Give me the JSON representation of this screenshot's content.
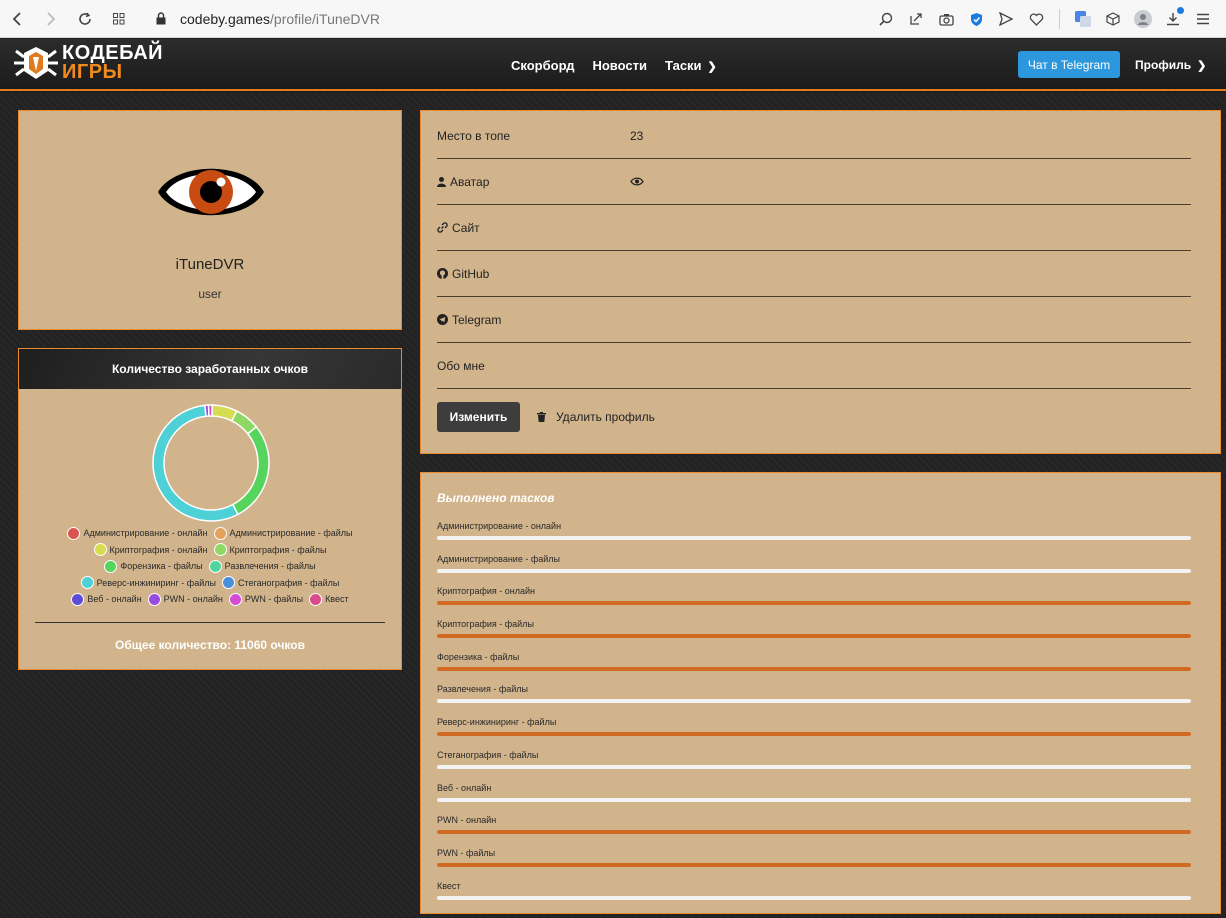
{
  "browser": {
    "url_host": "codeby.games",
    "url_path": "/profile/iTuneDVR"
  },
  "header": {
    "logo_top": "КОДЕБАЙ",
    "logo_bottom": "ИГРЫ",
    "nav": [
      {
        "label": "Скорборд"
      },
      {
        "label": "Новости"
      },
      {
        "label": "Таски"
      }
    ],
    "telegram_button": "Чат в Telegram",
    "profile_label": "Профиль"
  },
  "profile": {
    "username": "iTuneDVR",
    "role": "user"
  },
  "points": {
    "title": "Количество заработанных очков",
    "total_text": "Общее количество: 11060 очков",
    "legend": [
      {
        "label": "Администрирование - онлайн",
        "color": "#d9534f"
      },
      {
        "label": "Администрирование - файлы",
        "color": "#e3a35a"
      },
      {
        "label": "Криптография - онлайн",
        "color": "#d6dc4f"
      },
      {
        "label": "Криптография - файлы",
        "color": "#8ed964"
      },
      {
        "label": "Форензика - файлы",
        "color": "#55d45e"
      },
      {
        "label": "Развлечения - файлы",
        "color": "#4fd6a0"
      },
      {
        "label": "Реверс-инжиниринг - файлы",
        "color": "#4dd0d6"
      },
      {
        "label": "Стеганография - файлы",
        "color": "#4a8fdc"
      },
      {
        "label": "Веб - онлайн",
        "color": "#5d4cd8"
      },
      {
        "label": "PWN - онлайн",
        "color": "#9b4ce0"
      },
      {
        "label": "PWN - файлы",
        "color": "#d44cd4"
      },
      {
        "label": "Квест",
        "color": "#d94c8c"
      }
    ],
    "donut_segments": [
      {
        "category": "Криптография - онлайн",
        "value": 7
      },
      {
        "category": "Криптография - файлы",
        "value": 7
      },
      {
        "category": "Форензика - файлы",
        "value": 28
      },
      {
        "category": "Реверс-инжиниринг - файлы",
        "value": 56
      },
      {
        "category": "PWN - онлайн",
        "value": 1
      },
      {
        "category": "PWN - файлы",
        "value": 1
      }
    ]
  },
  "info": {
    "rows": [
      {
        "label": "Место в топе",
        "value": "23",
        "icon": ""
      },
      {
        "label": "Аватар",
        "value": "",
        "icon": "user-icon"
      },
      {
        "label": "Сайт",
        "value": "",
        "icon": "link-icon"
      },
      {
        "label": "GitHub",
        "value": "",
        "icon": "github-icon"
      },
      {
        "label": "Telegram",
        "value": "",
        "icon": "telegram-icon"
      },
      {
        "label": "Обо мне",
        "value": "",
        "icon": ""
      }
    ],
    "edit_button": "Изменить",
    "delete_label": "Удалить профиль"
  },
  "tasks": {
    "title": "Выполнено тасков",
    "items": [
      {
        "label": "Администрирование - онлайн",
        "progress": 0
      },
      {
        "label": "Администрирование - файлы",
        "progress": 0
      },
      {
        "label": "Криптография - онлайн",
        "progress": 1
      },
      {
        "label": "Криптография - файлы",
        "progress": 1
      },
      {
        "label": "Форензика - файлы",
        "progress": 1
      },
      {
        "label": "Развлечения - файлы",
        "progress": 0
      },
      {
        "label": "Реверс-инжиниринг - файлы",
        "progress": 1
      },
      {
        "label": "Стеганография - файлы",
        "progress": 0
      },
      {
        "label": "Веб - онлайн",
        "progress": 0
      },
      {
        "label": "PWN - онлайн",
        "progress": 1
      },
      {
        "label": "PWN - файлы",
        "progress": 1
      },
      {
        "label": "Квест",
        "progress": 0
      }
    ]
  }
}
